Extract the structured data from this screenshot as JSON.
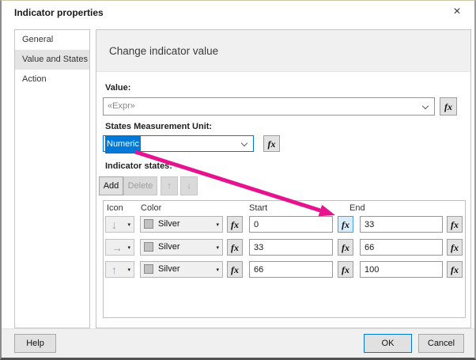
{
  "window": {
    "title": "Indicator properties",
    "close_glyph": "×"
  },
  "icons": {
    "caret": "▾"
  },
  "fx_label": "fx",
  "sidebar": {
    "items": [
      {
        "label": "General"
      },
      {
        "label": "Value and States"
      },
      {
        "label": "Action"
      }
    ]
  },
  "main": {
    "heading": "Change indicator value",
    "value": {
      "label": "Value:",
      "text": "«Expr»"
    },
    "unit": {
      "label": "States Measurement Unit:",
      "value": "Numeric"
    },
    "states": {
      "label": "Indicator states:",
      "add": "Add",
      "delete": "Delete",
      "move_up": "↑",
      "move_down": "↓",
      "columns": [
        "Icon",
        "Color",
        "Start",
        "End"
      ],
      "rows": [
        {
          "icon_name": "down-arrow",
          "icon": "↓",
          "color": "Silver",
          "start": "0",
          "end": "33"
        },
        {
          "icon_name": "right-arrow",
          "icon": "→",
          "color": "Silver",
          "start": "33",
          "end": "66"
        },
        {
          "icon_name": "up-arrow",
          "icon": "↑",
          "color": "Silver",
          "start": "66",
          "end": "100"
        }
      ]
    }
  },
  "footer": {
    "help": "Help",
    "ok": "OK",
    "cancel": "Cancel"
  },
  "annotation": {
    "shape": "arrow",
    "points_to": "start-expression-button-row-1"
  },
  "colors": {
    "accent": "#0078d7",
    "selection": "#0078d7",
    "silver": "#c1c1c1",
    "arrow": "#e6138f"
  }
}
